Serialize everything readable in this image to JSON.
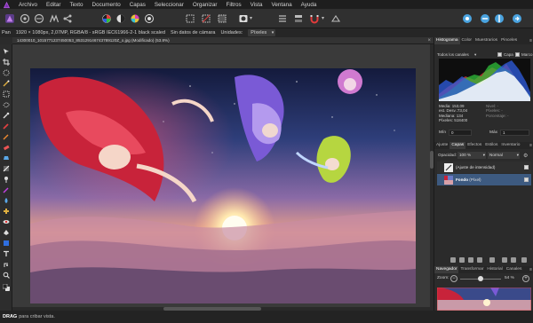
{
  "menubar": {
    "items": [
      "Archivo",
      "Editar",
      "Texto",
      "Documento",
      "Capas",
      "Seleccionar",
      "Organizar",
      "Filtros",
      "Vista",
      "Ventana",
      "Ayuda"
    ]
  },
  "contextbar": {
    "tool_name": "Pan",
    "doc_info": "1920 × 1080px, 2,07MP, RGBA/8 - sRGB IEC61966-2-1 black scaled",
    "camera_info": "Sin datos de cámara",
    "units_label": "Unidades:",
    "units_value": "Píxeles"
  },
  "document": {
    "tab_title": "14300010_1015771237450053_853129146743789120Z_o.jpg (Modificado) (53.8%)",
    "close_glyph": "×"
  },
  "panels": {
    "top_tabs": [
      "Histograma",
      "Color",
      "Muestrarios",
      "Pinceles"
    ],
    "histogram": {
      "channel": "Todos los canales",
      "layer_option": "Capa",
      "marquee_option": "Marco",
      "media": "Media: 153,09",
      "desv": "est. Desv.:73,04",
      "mediana": "Mediana: 134",
      "pixeles": "Píxeles: 518400",
      "nivel": "Nivel: -",
      "recuento": "Píxeles: -",
      "percentil": "Porcentaje: -",
      "min_label": "Mín",
      "min_value": "0",
      "max_label": "Máx",
      "max_value": "1"
    },
    "mid_tabs": [
      "Ajuste",
      "Capas",
      "Efectos",
      "Estilos",
      "Inventario"
    ],
    "layers": {
      "opacity_label": "Opacidad:",
      "opacity_value": "100 %",
      "blend_mode": "Normal",
      "items": [
        {
          "name": "(Ajuste de intensidad)",
          "bold": ""
        },
        {
          "name": " (Píxel)",
          "bold": "Fondo"
        }
      ]
    },
    "bottom_tabs": [
      "Navegador",
      "Transformar",
      "Historial",
      "Canales"
    ],
    "navigator": {
      "zoom_label": "Zoom:",
      "zoom_value": "54 %"
    }
  },
  "statusbar": {
    "action": "DRAG",
    "hint": "para cribar vista."
  },
  "colors": {
    "accent_selected": "#3d5a80",
    "histogram_red": "#e23b3b",
    "histogram_green": "#2fbf3a",
    "histogram_blue": "#2f5de2"
  }
}
